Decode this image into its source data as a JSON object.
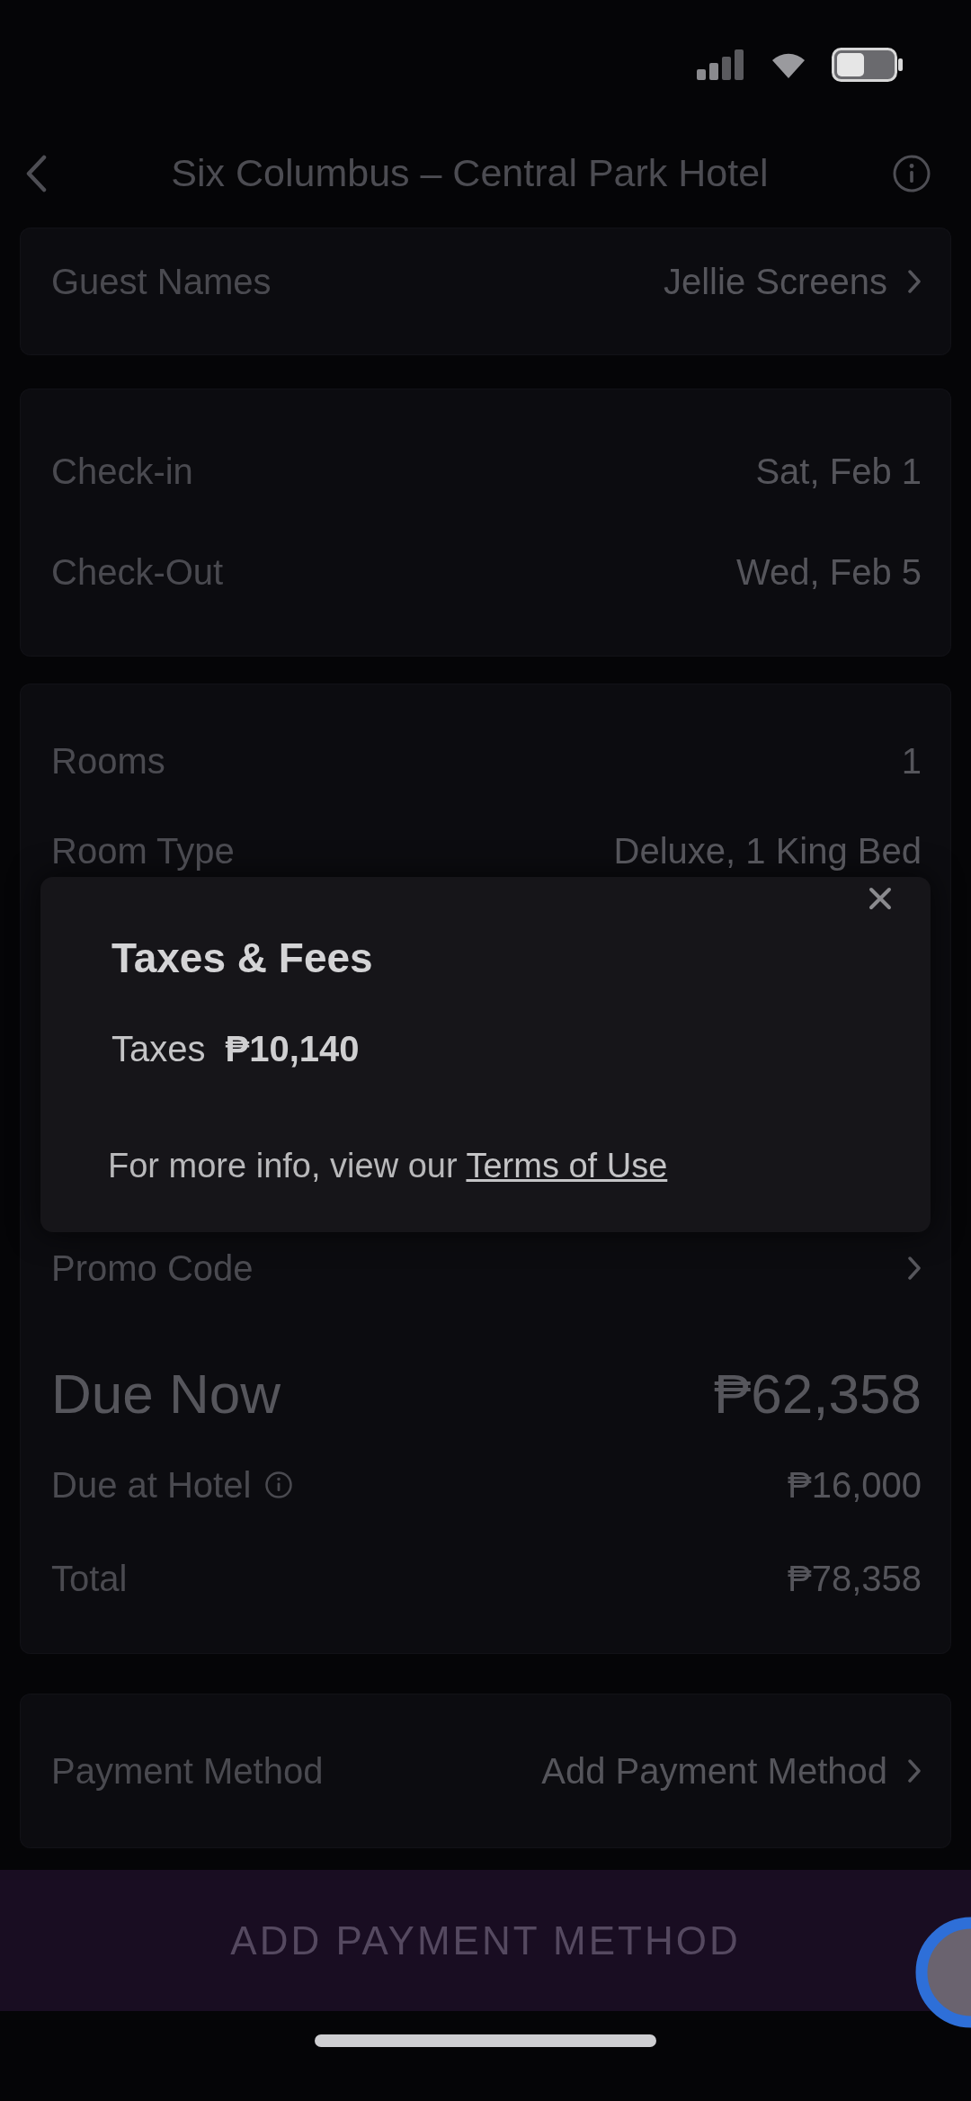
{
  "nav": {
    "title": "Six Columbus – Central Park Hotel"
  },
  "cards": [
    {
      "rows": [
        {
          "kind": "link",
          "label": "Guest Names",
          "value": "Jellie Screens"
        }
      ]
    },
    {
      "rows": [
        {
          "kind": "value",
          "label": "Check-in",
          "value": "Sat, Feb 1"
        },
        {
          "kind": "value",
          "label": "Check-Out",
          "value": "Wed, Feb 5"
        }
      ]
    }
  ],
  "summary": {
    "upper_rows": [
      {
        "kind": "value",
        "label": "Rooms",
        "value": "1"
      },
      {
        "kind": "value",
        "label": "Room Type",
        "value": "Deluxe, 1 King Bed"
      }
    ],
    "popup": {
      "title": "Taxes & Fees",
      "lines": [
        {
          "label": "Taxes",
          "amount": "₱10,140"
        }
      ],
      "note": "For more info, view our",
      "link": "Terms of Use"
    },
    "lower_rows": [
      {
        "kind": "link",
        "label": "Promo Code"
      },
      {
        "kind": "due",
        "label": "Due Now",
        "value": "₱62,358"
      },
      {
        "kind": "info",
        "label": "Due at Hotel",
        "value": "₱16,000"
      },
      {
        "kind": "value",
        "label": "Total",
        "value": "₱78,358"
      }
    ]
  },
  "payment_card": {
    "rows": [
      {
        "kind": "link",
        "label": "Payment Method",
        "value": "Add Payment Method"
      }
    ]
  },
  "footer": {
    "button": "ADD PAYMENT METHOD"
  }
}
